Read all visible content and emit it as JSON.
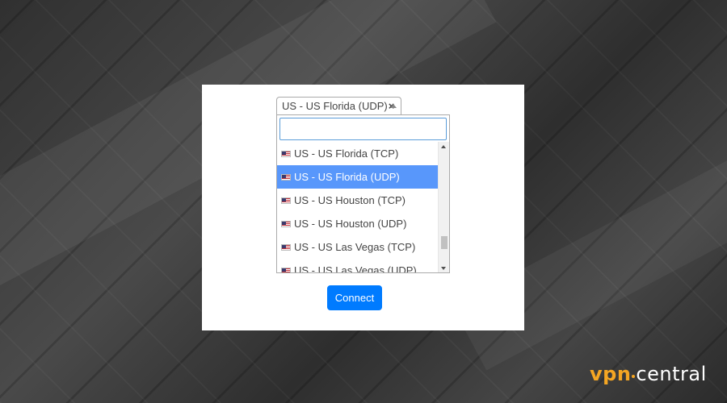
{
  "select": {
    "selected_value": "US - US Florida (UDP)",
    "clear_symbol": "×"
  },
  "dropdown": {
    "search_value": "",
    "options": [
      {
        "label": "US - US Florida (TCP)",
        "highlighted": false
      },
      {
        "label": "US - US Florida (UDP)",
        "highlighted": true
      },
      {
        "label": "US - US Houston (TCP)",
        "highlighted": false
      },
      {
        "label": "US - US Houston (UDP)",
        "highlighted": false
      },
      {
        "label": "US - US Las Vegas (TCP)",
        "highlighted": false
      },
      {
        "label": "US - US Las Vegas (UDP)",
        "highlighted": false
      }
    ]
  },
  "connect_label": "Connect",
  "logo": {
    "part1": "vpn",
    "part2": "central"
  },
  "colors": {
    "highlight": "#5897fb",
    "button": "#007bff",
    "logo_accent": "#f5a623"
  },
  "icons": {
    "flag": "us-flag-icon",
    "clear": "clear-icon",
    "dropdown_arrow": "arrow-up-icon"
  }
}
